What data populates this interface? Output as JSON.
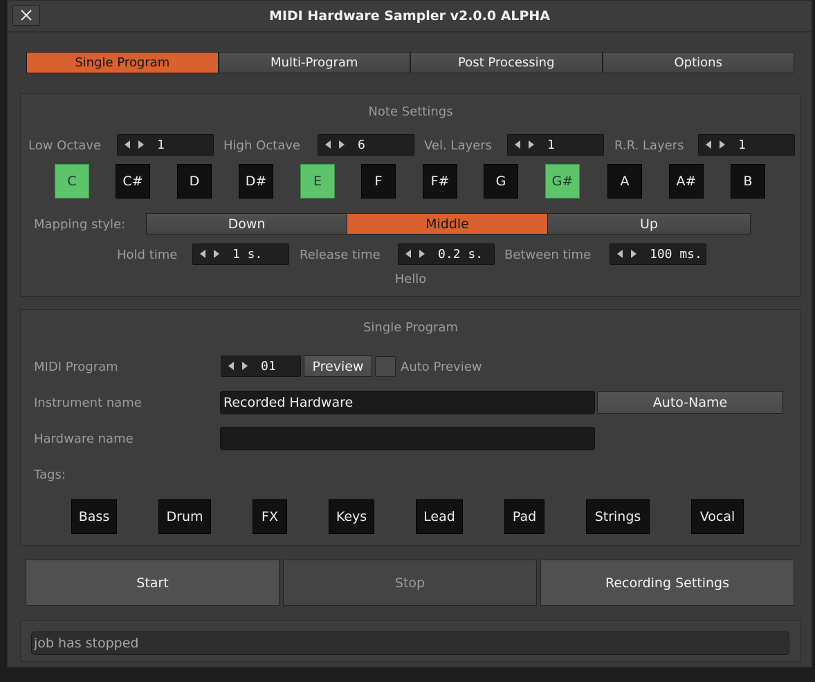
{
  "window": {
    "title": "MIDI Hardware Sampler v2.0.0 ALPHA"
  },
  "tabs": [
    {
      "label": "Single Program",
      "active": true
    },
    {
      "label": "Multi-Program",
      "active": false
    },
    {
      "label": "Post Processing",
      "active": false
    },
    {
      "label": "Options",
      "active": false
    }
  ],
  "note_settings": {
    "title": "Note Settings",
    "low_octave": {
      "label": "Low Octave",
      "value": "1"
    },
    "high_octave": {
      "label": "High Octave",
      "value": "6"
    },
    "vel_layers": {
      "label": "Vel. Layers",
      "value": "1"
    },
    "rr_layers": {
      "label": "R.R. Layers",
      "value": "1"
    },
    "notes": [
      {
        "label": "C",
        "on": true
      },
      {
        "label": "C#",
        "on": false
      },
      {
        "label": "D",
        "on": false
      },
      {
        "label": "D#",
        "on": false
      },
      {
        "label": "E",
        "on": true
      },
      {
        "label": "F",
        "on": false
      },
      {
        "label": "F#",
        "on": false
      },
      {
        "label": "G",
        "on": false
      },
      {
        "label": "G#",
        "on": true
      },
      {
        "label": "A",
        "on": false
      },
      {
        "label": "A#",
        "on": false
      },
      {
        "label": "B",
        "on": false
      }
    ],
    "mapping": {
      "label": "Mapping style:",
      "options": [
        "Down",
        "Middle",
        "Up"
      ],
      "selected": "Middle"
    },
    "hold_time": {
      "label": "Hold time",
      "value": "1 s."
    },
    "release_time": {
      "label": "Release time",
      "value": "0.2 s."
    },
    "between_time": {
      "label": "Between time",
      "value": "100 ms."
    },
    "hint": "Hello"
  },
  "single_program": {
    "title": "Single Program",
    "midi_program": {
      "label": "MIDI Program",
      "value": "01"
    },
    "preview_label": "Preview",
    "auto_preview_label": "Auto Preview",
    "auto_preview_checked": false,
    "instrument": {
      "label": "Instrument name",
      "value": "Recorded Hardware"
    },
    "auto_name_label": "Auto-Name",
    "hardware": {
      "label": "Hardware name",
      "value": ""
    },
    "tags_label": "Tags:",
    "tags": [
      "Bass",
      "Drum",
      "FX",
      "Keys",
      "Lead",
      "Pad",
      "Strings",
      "Vocal"
    ]
  },
  "actions": {
    "start": "Start",
    "stop": "Stop",
    "recording_settings": "Recording Settings"
  },
  "status": "job has stopped",
  "colors": {
    "accent": "#d9602f",
    "note_on": "#5ec46b",
    "background": "#3a3a3a"
  }
}
